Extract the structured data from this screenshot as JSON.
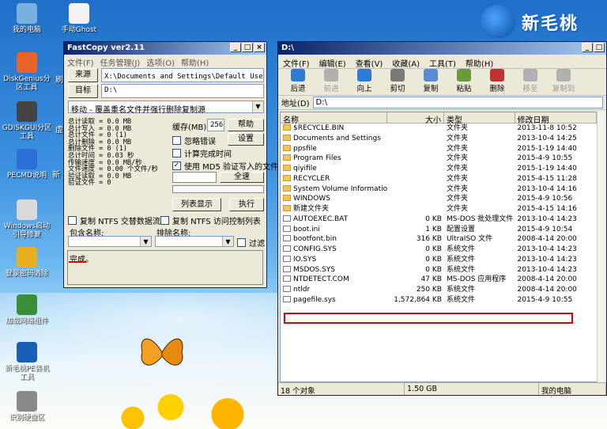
{
  "desktop": {
    "icons": [
      {
        "label": "我的电脑",
        "color": "#7ab0e0"
      },
      {
        "label": "手动Ghost",
        "color": "#f2f2f2"
      },
      {
        "label": "DiskGenius分区工具",
        "color": "#e8632a"
      },
      {
        "label": "GDISKGUI分区工具",
        "color": "#444444"
      },
      {
        "label": "PECMD说明",
        "color": "#2d6fd6"
      },
      {
        "label": "Windows启动引导修复",
        "color": "#d9d9d9"
      },
      {
        "label": "登录密码清除",
        "color": "#e8b020"
      },
      {
        "label": "加载网络组件",
        "color": "#3a8d3a"
      },
      {
        "label": "新毛桃PE装机工具",
        "color": "#1a5fb4"
      },
      {
        "label": "识别硬盘区",
        "color": "#8a8a8a"
      }
    ],
    "cut_labels": [
      "刷",
      "虚",
      "新"
    ],
    "logo_text": "新毛桃"
  },
  "fastcopy": {
    "title": "FastCopy ver2.11",
    "menu": [
      "文件(F)",
      "任务管理(J)",
      "选项(O)",
      "帮助(H)"
    ],
    "source_btn": "来源",
    "source_path": "X:\\Documents and Settings\\Default User\\桌面",
    "target_btn": "目标",
    "target_path": "D:\\",
    "mode": "移动 - 覆盖重名文件并强行删除复制源",
    "stats": "总计读取 = 0.0 MB\n总计写入 = 0.0 MB\n总计文件 = 0 (1)\n总计删除 = 0.0 MB\n删除文件 = 0 (1)\n总计时间 = 0.03 秒\n传输速度 = 0.0 MB/秒\n文件速度 = 0.00 个文件/秒\n验证读取 = 0.0 MB\n验证文件 = 0",
    "buffer_label": "缓存(MB)",
    "buffer_value": "256",
    "help_btn": "帮助",
    "ignore_errors": "忽略错误",
    "settings_btn": "设置",
    "estimate_time": "计算完成时间",
    "use_md5": "使用 MD5 验证写入的文件",
    "all_label": "全速",
    "list_btn": "列表显示",
    "exec_btn": "执行",
    "copy_ntfs_streams": "复制 NTFS 交替数据流",
    "copy_ntfs_acl": "复制 NTFS 访问控制列表",
    "include_label": "包含名称:",
    "exclude_label": "排除名称:",
    "filter_label": "过滤",
    "status_text": "完成。"
  },
  "explorer": {
    "title": "D:\\",
    "menu": [
      "文件(F)",
      "编辑(E)",
      "查看(V)",
      "收藏(A)",
      "工具(T)",
      "帮助(H)"
    ],
    "toolbar": [
      {
        "label": "后退",
        "color": "#2e7bd6",
        "enabled": true
      },
      {
        "label": "前进",
        "color": "#b0b0b0",
        "enabled": false
      },
      {
        "label": "向上",
        "color": "#2e7bd6",
        "enabled": true
      },
      {
        "label": "剪切",
        "color": "#7a7a7a",
        "enabled": true
      },
      {
        "label": "复制",
        "color": "#5b8bd0",
        "enabled": true
      },
      {
        "label": "粘贴",
        "color": "#6a9a3a",
        "enabled": true
      },
      {
        "label": "删除",
        "color": "#c03030",
        "enabled": true
      },
      {
        "label": "移至",
        "color": "#b0b0b0",
        "enabled": false
      },
      {
        "label": "复制到",
        "color": "#b0b0b0",
        "enabled": false
      }
    ],
    "address_label": "地址(D)",
    "address_value": "D:\\",
    "columns": [
      "名称",
      "大小",
      "类型",
      "修改日期"
    ],
    "rows": [
      {
        "name": "$RECYCLE.BIN",
        "size": "",
        "type": "文件夹",
        "date": "2013-11-8 10:52",
        "kind": "folder"
      },
      {
        "name": "Documents and Settings",
        "size": "",
        "type": "文件夹",
        "date": "2013-10-4 14:25",
        "kind": "folder"
      },
      {
        "name": "ppsfile",
        "size": "",
        "type": "文件夹",
        "date": "2015-1-19 14:40",
        "kind": "folder"
      },
      {
        "name": "Program Files",
        "size": "",
        "type": "文件夹",
        "date": "2015-4-9 10:55",
        "kind": "folder"
      },
      {
        "name": "qiyifile",
        "size": "",
        "type": "文件夹",
        "date": "2015-1-19 14:40",
        "kind": "folder"
      },
      {
        "name": "RECYCLER",
        "size": "",
        "type": "文件夹",
        "date": "2015-4-15 11:28",
        "kind": "folder"
      },
      {
        "name": "System Volume Information",
        "size": "",
        "type": "文件夹",
        "date": "2013-10-4 14:16",
        "kind": "folder"
      },
      {
        "name": "WINDOWS",
        "size": "",
        "type": "文件夹",
        "date": "2015-4-9 10:56",
        "kind": "folder"
      },
      {
        "name": "新建文件夹",
        "size": "",
        "type": "文件夹",
        "date": "2015-4-15 14:16",
        "kind": "folder"
      },
      {
        "name": "AUTOEXEC.BAT",
        "size": "0 KB",
        "type": "MS-DOS 批处理文件",
        "date": "2013-10-4 14:23",
        "kind": "file"
      },
      {
        "name": "boot.ini",
        "size": "1 KB",
        "type": "配置设置",
        "date": "2015-4-9 10:54",
        "kind": "file"
      },
      {
        "name": "bootfont.bin",
        "size": "316 KB",
        "type": "UltraISO 文件",
        "date": "2008-4-14 20:00",
        "kind": "file"
      },
      {
        "name": "CONFIG.SYS",
        "size": "0 KB",
        "type": "系统文件",
        "date": "2013-10-4 14:23",
        "kind": "file"
      },
      {
        "name": "IO.SYS",
        "size": "0 KB",
        "type": "系统文件",
        "date": "2013-10-4 14:23",
        "kind": "file"
      },
      {
        "name": "MSDOS.SYS",
        "size": "0 KB",
        "type": "系统文件",
        "date": "2013-10-4 14:23",
        "kind": "file"
      },
      {
        "name": "NTDETECT.COM",
        "size": "47 KB",
        "type": "MS-DOS 应用程序",
        "date": "2008-4-14 20:00",
        "kind": "file"
      },
      {
        "name": "ntldr",
        "size": "250 KB",
        "type": "系统文件",
        "date": "2008-4-14 20:00",
        "kind": "file"
      },
      {
        "name": "pagefile.sys",
        "size": "1,572,864 KB",
        "type": "系统文件",
        "date": "2015-4-9 10:55",
        "kind": "file"
      }
    ],
    "status_count": "18 个对象",
    "status_size": "1.50 GB",
    "status_location": "我的电脑"
  }
}
